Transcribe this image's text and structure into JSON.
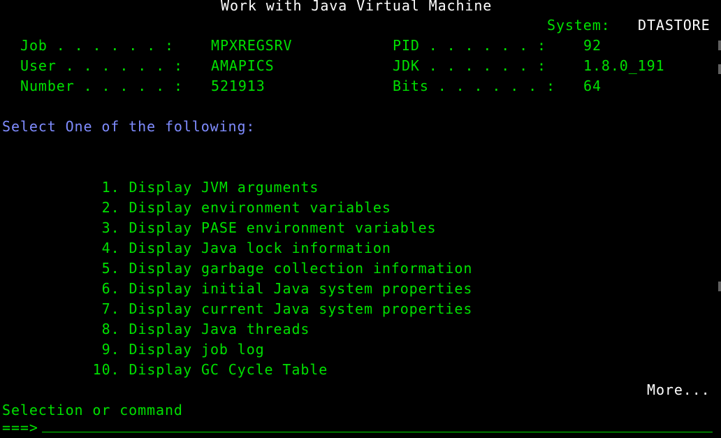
{
  "screen": {
    "title": "Work with Java Virtual Machine",
    "system_label": "System:",
    "system_value": "DTASTORE"
  },
  "job_info": {
    "job_label": "Job . . . . . . :",
    "job_value": "MPXREGSRV",
    "user_label": "User . . . . . . :",
    "user_value": "AMAPICS",
    "number_label": "Number . . . . . :",
    "number_value": "521913",
    "pid_label": "PID . . . . . . :",
    "pid_value": "92",
    "jdk_label": "JDK . . . . . . :",
    "jdk_value": "1.8.0_191",
    "bits_label": "Bits . . . . . . :",
    "bits_value": "64"
  },
  "instructions": "Select One of the following:",
  "menu": {
    "options": [
      {
        "num": "1.",
        "label": "Display JVM arguments"
      },
      {
        "num": "2.",
        "label": "Display environment variables"
      },
      {
        "num": "3.",
        "label": "Display PASE environment variables"
      },
      {
        "num": "4.",
        "label": "Display Java lock information"
      },
      {
        "num": "5.",
        "label": "Display garbage collection information"
      },
      {
        "num": "6.",
        "label": "Display initial Java system properties"
      },
      {
        "num": "7.",
        "label": "Display current Java system properties"
      },
      {
        "num": "8.",
        "label": "Display Java threads"
      },
      {
        "num": "9.",
        "label": "Display job log"
      },
      {
        "num": "10.",
        "label": "Display GC Cycle Table"
      }
    ]
  },
  "more_indicator": "More...",
  "command_prompt": {
    "label": "Selection or command",
    "arrow": "===>"
  },
  "colors": {
    "background": "#000000",
    "green": "#00e000",
    "white": "#ffffff",
    "blue": "#7f8cff"
  }
}
